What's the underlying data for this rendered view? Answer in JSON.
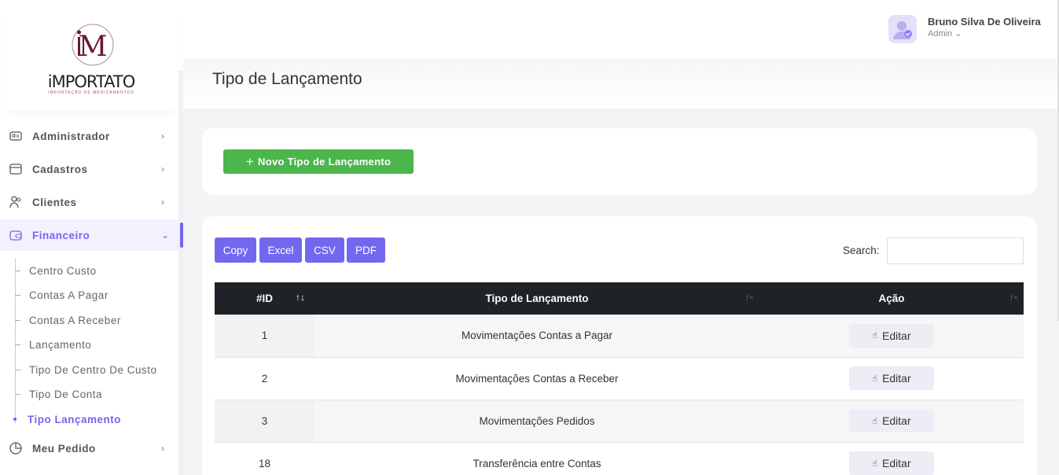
{
  "brand": {
    "name": "iMPORTATO",
    "tagline": "IMPORTAÇÃO DE MEDICAMENTOS"
  },
  "menu": [
    {
      "label": "Administrador",
      "icon": "card-icon"
    },
    {
      "label": "Cadastros",
      "icon": "window-icon"
    },
    {
      "label": "Clientes",
      "icon": "users-icon"
    },
    {
      "label": "Financeiro",
      "icon": "wallet-icon",
      "active": true
    },
    {
      "label": "Meu Pedido",
      "icon": "chart-pie-icon"
    }
  ],
  "submenu": [
    {
      "label": "Centro Custo"
    },
    {
      "label": "Contas A Pagar"
    },
    {
      "label": "Contas A Receber"
    },
    {
      "label": "Lançamento"
    },
    {
      "label": "Tipo De Centro De Custo"
    },
    {
      "label": "Tipo De Conta"
    },
    {
      "label": "Tipo Lançamento",
      "active": true
    }
  ],
  "user": {
    "name": "Bruno Silva De Oliveira",
    "role": "Admin ⌄"
  },
  "page": {
    "title": "Tipo de Lançamento"
  },
  "actions": {
    "new_label": "Novo Tipo de Lançamento"
  },
  "export": {
    "copy": "Copy",
    "excel": "Excel",
    "csv": "CSV",
    "pdf": "PDF"
  },
  "search": {
    "label": "Search:",
    "value": ""
  },
  "table": {
    "headers": {
      "id": "#ID",
      "tipo": "Tipo de Lançamento",
      "acao": "Ação"
    },
    "rows": [
      {
        "id": "1",
        "tipo": "Movimentações Contas a Pagar",
        "action": "Editar"
      },
      {
        "id": "2",
        "tipo": "Movimentações Contas a Receber",
        "action": "Editar"
      },
      {
        "id": "3",
        "tipo": "Movimentações Pedidos",
        "action": "Editar"
      },
      {
        "id": "18",
        "tipo": "Transferência entre Contas",
        "action": "Editar"
      }
    ]
  },
  "colors": {
    "accent": "#7367f0",
    "success": "#4bb64b",
    "table_header": "#1f2227"
  }
}
